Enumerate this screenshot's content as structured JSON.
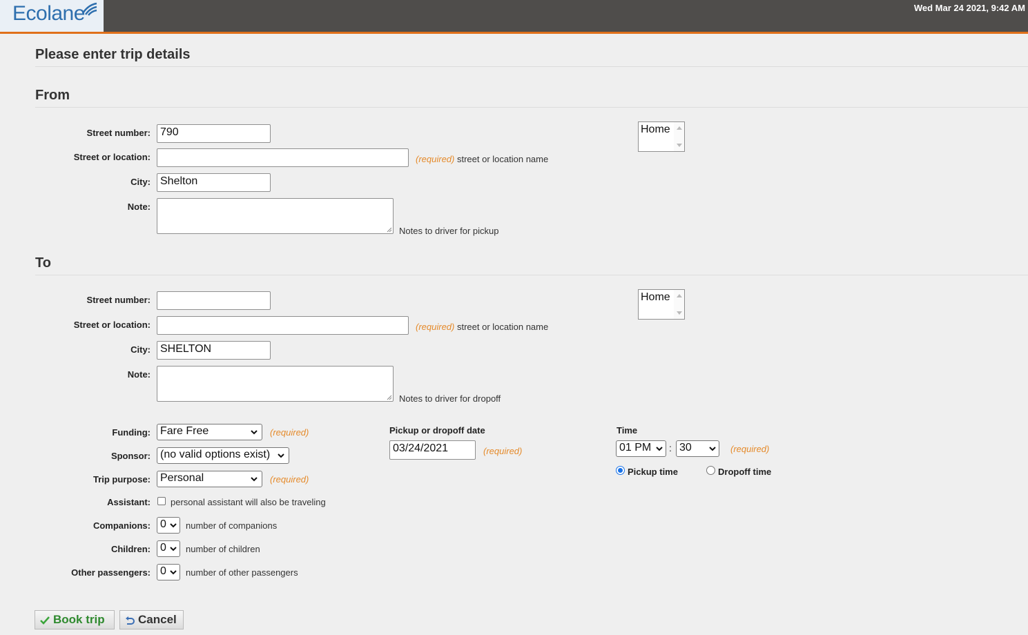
{
  "header": {
    "logo": "Ecolane",
    "datetime": "Wed Mar 24 2021, 9:42 AM",
    "colors": {
      "bar": "#4f4d4b",
      "accent": "#e0701a",
      "logo": "#2e6fae"
    }
  },
  "page_title": "Please enter trip details",
  "from": {
    "heading": "From",
    "street_number_label": "Street number:",
    "street_number_value": "790",
    "street_location_label": "Street or location:",
    "street_location_value": "",
    "required": "(required)",
    "street_location_hint": "street or location name",
    "city_label": "City:",
    "city_value": "Shelton",
    "note_label": "Note:",
    "note_hint": "Notes to driver for pickup",
    "saved_location": "Home"
  },
  "to": {
    "heading": "To",
    "street_number_label": "Street number:",
    "street_number_value": "",
    "street_location_label": "Street or location:",
    "street_location_value": "",
    "required": "(required)",
    "street_location_hint": "street or location name",
    "city_label": "City:",
    "city_value": "SHELTON",
    "note_label": "Note:",
    "note_hint": "Notes to driver for dropoff",
    "saved_location": "Home"
  },
  "details": {
    "funding_label": "Funding:",
    "funding_value": "Fare Free",
    "sponsor_label": "Sponsor:",
    "sponsor_value": "(no valid options exist)",
    "purpose_label": "Trip purpose:",
    "purpose_value": "Personal",
    "assistant_label": "Assistant:",
    "assistant_hint": "personal assistant will also be traveling",
    "companions_label": "Companions:",
    "companions_value": "0",
    "companions_hint": "number of companions",
    "children_label": "Children:",
    "children_value": "0",
    "children_hint": "number of children",
    "others_label": "Other passengers:",
    "others_value": "0",
    "others_hint": "number of other passengers",
    "required": "(required)"
  },
  "date": {
    "label": "Pickup or dropoff date",
    "value": "03/24/2021",
    "required": "(required)"
  },
  "time": {
    "label": "Time",
    "hour": "01 PM",
    "separator": ":",
    "minute": "30",
    "required": "(required)",
    "pickup_label": "Pickup time",
    "dropoff_label": "Dropoff time",
    "selected": "Pickup time"
  },
  "actions": {
    "book_label": "Book trip",
    "cancel_label": "Cancel"
  }
}
